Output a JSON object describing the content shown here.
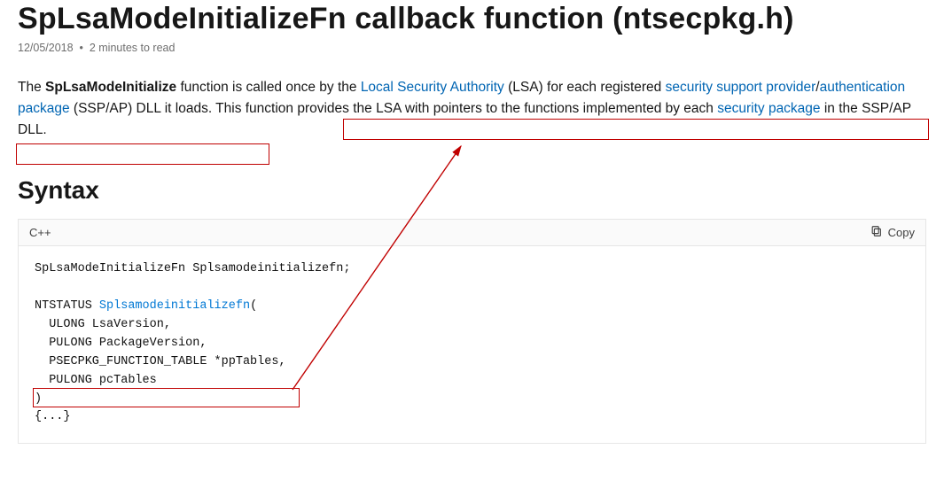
{
  "header": {
    "title": "SpLsaModeInitializeFn callback function (ntsecpkg.h)",
    "date": "12/05/2018",
    "readtime": "2 minutes to read"
  },
  "intro": {
    "prefix": "The ",
    "bold_fn": "SpLsaModeInitialize",
    "after_bold": " function is called once by the ",
    "link_lsa": "Local Security Authority",
    "after_lsa": " (LSA) for each registered ",
    "link_ssp": "security support provider",
    "slash": "/",
    "link_ap": "authentication package",
    "after_ap": " (SSP/AP) DLL it loads. ",
    "hl_part1": "This function provides the LSA with pointers to the functions implemented by each ",
    "link_sp": "security package",
    "hl_part2": " in the SSP/AP DLL."
  },
  "syntax_heading": "Syntax",
  "codeheader": {
    "lang": "C++",
    "copy": "Copy"
  },
  "code": {
    "line1_a": "SpLsaModeInitializeFn Splsamodeinitializefn;",
    "line3_a": "NTSTATUS ",
    "line3_fn": "Splsamodeinitializefn",
    "line3_b": "(",
    "line4": "  ULONG LsaVersion,",
    "line5": "  PULONG PackageVersion,",
    "line6": "  PSECPKG_FUNCTION_TABLE *ppTables,",
    "line7": "  PULONG pcTables",
    "line8": ")",
    "line9": "{...}"
  }
}
